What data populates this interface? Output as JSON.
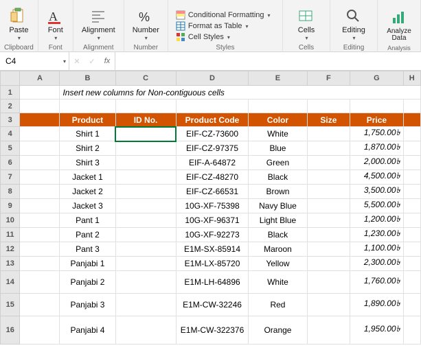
{
  "ribbon": {
    "clipboard": {
      "group": "Clipboard",
      "paste": "Paste"
    },
    "font": {
      "group": "Font",
      "label": "Font"
    },
    "align": {
      "group": "Alignment",
      "label": "Alignment"
    },
    "number": {
      "group": "Number",
      "label": "Number",
      "percent": "%"
    },
    "styles": {
      "group": "Styles",
      "cond": "Conditional Formatting",
      "table": "Format as Table",
      "cell": "Cell Styles"
    },
    "cells": {
      "group": "Cells",
      "label": "Cells"
    },
    "editing": {
      "group": "Editing",
      "label": "Editing"
    },
    "analysis": {
      "group": "Analysis",
      "label": "Analyze Data"
    }
  },
  "formula": {
    "name": "C4",
    "fx": "fx"
  },
  "cols": [
    "A",
    "B",
    "C",
    "D",
    "E",
    "F",
    "G",
    "H"
  ],
  "title": "Insert new columns for Non-contiguous cells",
  "headers": {
    "b": "Product",
    "c": "ID No.",
    "d": "Product Code",
    "e": "Color",
    "f": "Size",
    "g": "Price"
  },
  "rows": [
    {
      "n": 4,
      "b": "Shirt 1",
      "d": "EIF-CZ-73600",
      "e": "White",
      "g": "1,750.00৳"
    },
    {
      "n": 5,
      "b": "Shirt 2",
      "d": "EIF-CZ-97375",
      "e": "Blue",
      "g": "1,870.00৳"
    },
    {
      "n": 6,
      "b": "Shirt 3",
      "d": "EIF-A-64872",
      "e": "Green",
      "g": "2,000.00৳"
    },
    {
      "n": 7,
      "b": "Jacket 1",
      "d": "EIF-CZ-48270",
      "e": "Black",
      "g": "4,500.00৳"
    },
    {
      "n": 8,
      "b": "Jacket 2",
      "d": "EIF-CZ-66531",
      "e": "Brown",
      "g": "3,500.00৳"
    },
    {
      "n": 9,
      "b": "Jacket 3",
      "d": "10G-XF-75398",
      "e": "Navy Blue",
      "g": "5,500.00৳"
    },
    {
      "n": 10,
      "b": "Pant 1",
      "d": "10G-XF-96371",
      "e": "Light Blue",
      "g": "1,200.00৳"
    },
    {
      "n": 11,
      "b": "Pant 2",
      "d": "10G-XF-92273",
      "e": "Black",
      "g": "1,230.00৳"
    },
    {
      "n": 12,
      "b": "Pant 3",
      "d": "E1M-SX-85914",
      "e": "Maroon",
      "g": "1,100.00৳"
    },
    {
      "n": 13,
      "b": "Panjabi 1",
      "d": "E1M-LX-85720",
      "e": "Yellow",
      "g": "2,300.00৳"
    },
    {
      "n": 14,
      "b": "Panjabi 2",
      "d": "E1M-LH-64896",
      "e": "White",
      "g": "1,760.00৳",
      "tall": 1
    },
    {
      "n": 15,
      "b": "Panjabi 3",
      "d": "E1M-CW-32246",
      "e": "Red",
      "g": "1,890.00৳",
      "tall": 1
    },
    {
      "n": 16,
      "b": "Panjabi 4",
      "d": "E1M-CW-322376",
      "e": "Orange",
      "g": "1,950.00৳",
      "taller": 1
    }
  ],
  "chart_data": {
    "type": "table",
    "title": "Insert new columns for Non-contiguous cells",
    "columns": [
      "Product",
      "ID No.",
      "Product Code",
      "Color",
      "Size",
      "Price"
    ],
    "rows": [
      [
        "Shirt 1",
        "",
        "EIF-CZ-73600",
        "White",
        "",
        "1,750.00৳"
      ],
      [
        "Shirt 2",
        "",
        "EIF-CZ-97375",
        "Blue",
        "",
        "1,870.00৳"
      ],
      [
        "Shirt 3",
        "",
        "EIF-A-64872",
        "Green",
        "",
        "2,000.00৳"
      ],
      [
        "Jacket 1",
        "",
        "EIF-CZ-48270",
        "Black",
        "",
        "4,500.00৳"
      ],
      [
        "Jacket 2",
        "",
        "EIF-CZ-66531",
        "Brown",
        "",
        "3,500.00৳"
      ],
      [
        "Jacket 3",
        "",
        "10G-XF-75398",
        "Navy Blue",
        "",
        "5,500.00৳"
      ],
      [
        "Pant 1",
        "",
        "10G-XF-96371",
        "Light Blue",
        "",
        "1,200.00৳"
      ],
      [
        "Pant 2",
        "",
        "10G-XF-92273",
        "Black",
        "",
        "1,230.00৳"
      ],
      [
        "Pant 3",
        "",
        "E1M-SX-85914",
        "Maroon",
        "",
        "1,100.00৳"
      ],
      [
        "Panjabi 1",
        "",
        "E1M-LX-85720",
        "Yellow",
        "",
        "2,300.00৳"
      ],
      [
        "Panjabi 2",
        "",
        "E1M-LH-64896",
        "White",
        "",
        "1,760.00৳"
      ],
      [
        "Panjabi 3",
        "",
        "E1M-CW-32246",
        "Red",
        "",
        "1,890.00৳"
      ],
      [
        "Panjabi 4",
        "",
        "E1M-CW-322376",
        "Orange",
        "",
        "1,950.00৳"
      ]
    ]
  }
}
